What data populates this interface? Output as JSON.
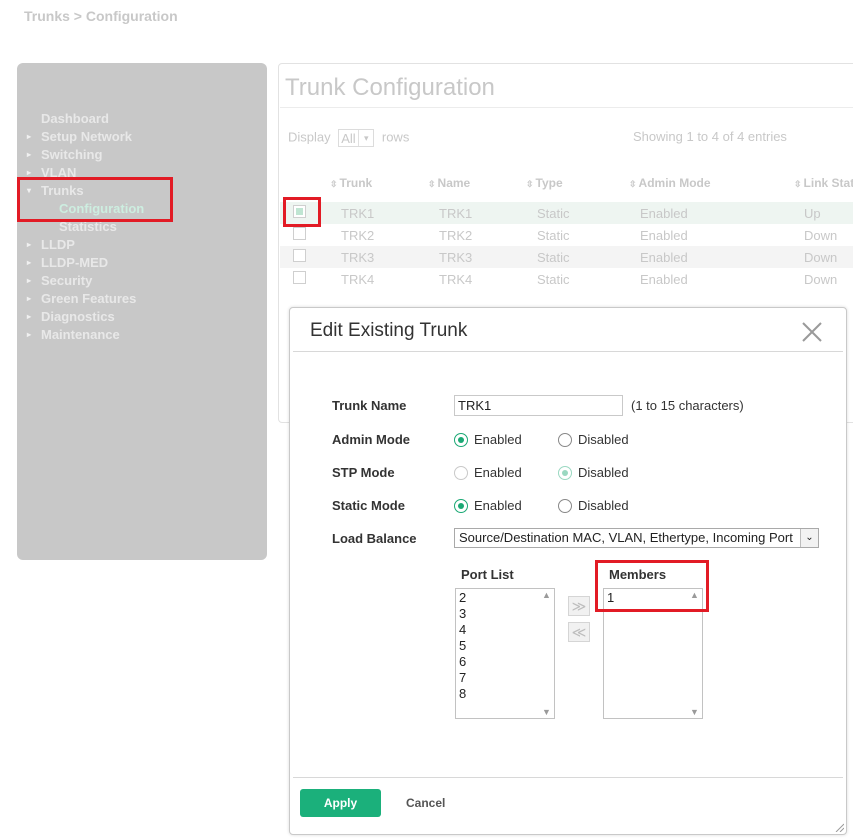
{
  "breadcrumb": "Trunks > Configuration",
  "sidebar": {
    "items": [
      {
        "label": "Dashboard",
        "arrow": ""
      },
      {
        "label": "Setup Network",
        "arrow": "▸"
      },
      {
        "label": "Switching",
        "arrow": "▸"
      },
      {
        "label": "VLAN",
        "arrow": "▸"
      },
      {
        "label": "Trunks",
        "arrow": "▾"
      },
      {
        "label": "Configuration",
        "arrow": ""
      },
      {
        "label": "Statistics",
        "arrow": ""
      },
      {
        "label": "LLDP",
        "arrow": "▸"
      },
      {
        "label": "LLDP-MED",
        "arrow": "▸"
      },
      {
        "label": "Security",
        "arrow": "▸"
      },
      {
        "label": "Green Features",
        "arrow": "▸"
      },
      {
        "label": "Diagnostics",
        "arrow": "▸"
      },
      {
        "label": "Maintenance",
        "arrow": "▸"
      }
    ]
  },
  "page": {
    "title": "Trunk Configuration",
    "display_label": "Display",
    "display_value": "All",
    "rows_label": "rows",
    "showing": "Showing 1 to 4 of 4 entries"
  },
  "table": {
    "columns": [
      "Trunk",
      "Name",
      "Type",
      "Admin Mode",
      "Link Stat"
    ],
    "rows": [
      {
        "trunk": "TRK1",
        "name": "TRK1",
        "type": "Static",
        "admin": "Enabled",
        "link": "Up",
        "checked": true
      },
      {
        "trunk": "TRK2",
        "name": "TRK2",
        "type": "Static",
        "admin": "Enabled",
        "link": "Down",
        "checked": false
      },
      {
        "trunk": "TRK3",
        "name": "TRK3",
        "type": "Static",
        "admin": "Enabled",
        "link": "Down",
        "checked": false
      },
      {
        "trunk": "TRK4",
        "name": "TRK4",
        "type": "Static",
        "admin": "Enabled",
        "link": "Down",
        "checked": false
      }
    ]
  },
  "modal": {
    "title": "Edit Existing Trunk",
    "trunk_name_label": "Trunk Name",
    "trunk_name_value": "TRK1",
    "trunk_name_hint": "(1 to 15 characters)",
    "admin_mode_label": "Admin Mode",
    "stp_mode_label": "STP Mode",
    "static_mode_label": "Static Mode",
    "enabled_label": "Enabled",
    "disabled_label": "Disabled",
    "admin_mode_value": "Enabled",
    "stp_mode_value": "Disabled",
    "static_mode_value": "Enabled",
    "load_balance_label": "Load Balance",
    "load_balance_value": "Source/Destination MAC, VLAN, Ethertype, Incoming Port",
    "port_list_label": "Port List",
    "port_list": [
      "2",
      "3",
      "4",
      "5",
      "6",
      "7",
      "8"
    ],
    "members_label": "Members",
    "members": [
      "1"
    ],
    "add_symbol": "≫",
    "remove_symbol": "≪",
    "apply_label": "Apply",
    "cancel_label": "Cancel"
  },
  "colors": {
    "accent": "#1bb07b",
    "highlight": "#e21b25",
    "sidebar_bg": "#c8c8c8"
  }
}
